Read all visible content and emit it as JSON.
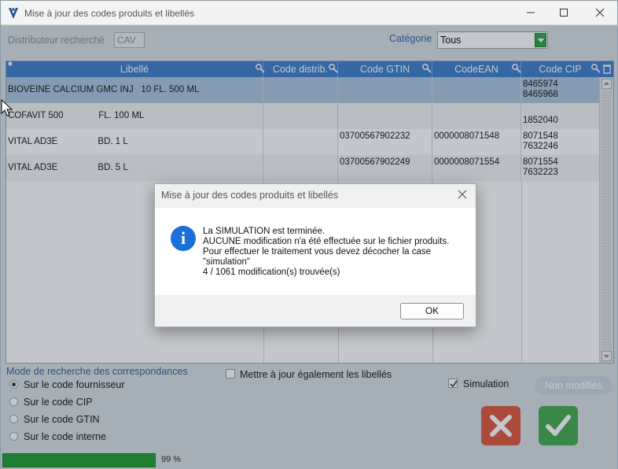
{
  "window": {
    "title": "Mise à jour des codes produits et libellés",
    "minimize": "—",
    "maximize": "☐",
    "close": "✕"
  },
  "filters": {
    "distributor_label": "Distributeur recherché",
    "distributor_value": "CAV",
    "category_label": "Catégorie",
    "category_value": "Tous"
  },
  "table": {
    "columns": [
      "Libellé",
      "Code distrib.",
      "Code GTIN",
      "CodeEAN",
      "Code CIP"
    ],
    "rows": [
      {
        "libelle": "BIOVEINE CALCIUM GMC INJ   10 FL. 500 ML",
        "code_distrib": "",
        "gtin": "",
        "ean": "",
        "cip": "8465974\n8465968",
        "selected": true
      },
      {
        "libelle": "COFAVIT 500              FL. 100 ML",
        "code_distrib": "",
        "gtin": "",
        "ean": "",
        "cip": "\n1852040",
        "selected": false
      },
      {
        "libelle": "VITAL AD3E                BD. 1 L",
        "code_distrib": "",
        "gtin": "03700567902232",
        "ean": "0000008071548",
        "cip": "8071548\n7632246",
        "selected": false
      },
      {
        "libelle": "VITAL AD3E                BD. 5 L",
        "code_distrib": "",
        "gtin": "03700567902249",
        "ean": "0000008071554",
        "cip": "8071554\n7632223",
        "selected": false
      }
    ]
  },
  "search_mode": {
    "title": "Mode de recherche des correspondances",
    "options": [
      "Sur le code fournisseur",
      "Sur le code CIP",
      "Sur le code GTIN",
      "Sur le code interne"
    ],
    "selected": 0
  },
  "options": {
    "update_labels": "Mettre à jour également les libellés",
    "update_labels_checked": false,
    "simulation": "Simulation",
    "simulation_checked": true,
    "non_modified": "Non modifiés"
  },
  "progress": {
    "percent": 99,
    "text": "99 %"
  },
  "dialog": {
    "title": "Mise à jour des codes produits et libellés",
    "message": "La SIMULATION est terminée.\nAUCUNE modification n'a été effectuée sur le fichier produits.\nPour effectuer le traitement vous devez décocher la case\n\"simulation\"\n4 / 1061 modification(s) trouvée(s)",
    "ok": "OK"
  },
  "colors": {
    "header_blue": "#3a7bc8",
    "accent_green": "#2ea043",
    "cancel_red": "#e0523a",
    "info_blue": "#1c6fd8"
  }
}
